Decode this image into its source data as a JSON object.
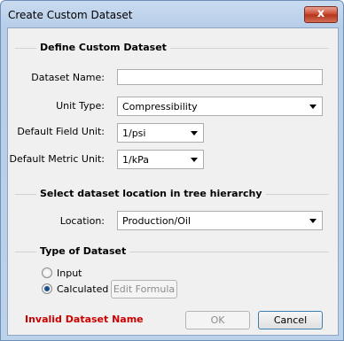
{
  "window": {
    "title": "Create Custom Dataset",
    "close_glyph": "x"
  },
  "section1": {
    "heading": "Define Custom Dataset",
    "dataset_name_label": "Dataset Name:",
    "dataset_name_value": "",
    "unit_type_label": "Unit Type:",
    "unit_type_value": "Compressibility",
    "field_unit_label": "Default Field Unit:",
    "field_unit_value": "1/psi",
    "metric_unit_label": "Default Metric Unit:",
    "metric_unit_value": "1/kPa"
  },
  "section2": {
    "heading": "Select dataset location in tree hierarchy",
    "location_label": "Location:",
    "location_value": "Production/Oil"
  },
  "section3": {
    "heading": "Type of Dataset",
    "input_label": "Input",
    "calculated_label": "Calculated",
    "selected": "Calculated",
    "edit_formula_label": "Edit Formula"
  },
  "footer": {
    "error_text": "Invalid Dataset Name",
    "ok_label": "OK",
    "cancel_label": "Cancel"
  },
  "colors": {
    "error": "#cc0000",
    "title_bar": "#bcd1ea",
    "client_bg": "#f0f0f0"
  }
}
